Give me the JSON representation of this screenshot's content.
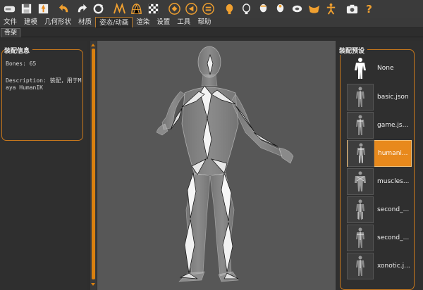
{
  "toolbar": {
    "icons": [
      "hard-drive-icon",
      "save-icon",
      "export-icon",
      "undo-icon",
      "redo-icon",
      "reset-icon",
      "wireframe-icon",
      "smooth-icon",
      "checker-icon",
      "front-view-icon",
      "back-view-icon",
      "side-view-icon",
      "head-front-icon",
      "head-side-icon",
      "head-back-icon",
      "head-top-icon",
      "face-icon",
      "arms-icon",
      "pose-icon",
      "camera-icon",
      "help-icon"
    ],
    "help_label": "?"
  },
  "menu": {
    "items": [
      "文件",
      "建模",
      "几何形状",
      "材质",
      "姿态/动画",
      "渲染",
      "设置",
      "工具",
      "帮助"
    ],
    "active_index": 4
  },
  "subtab": {
    "label": "骨架"
  },
  "info_panel": {
    "title": "装配信息",
    "bones_line": "Bones: 65",
    "description_line": "Description: 装配，用于Maya HumanIK"
  },
  "preset_panel": {
    "title": "装配预设",
    "items": [
      {
        "label": "None",
        "selected": false
      },
      {
        "label": "basic.json",
        "selected": false
      },
      {
        "label": "game.js...",
        "selected": false
      },
      {
        "label": "humani...",
        "selected": true
      },
      {
        "label": "muscles...",
        "selected": false
      },
      {
        "label": "second_...",
        "selected": false
      },
      {
        "label": "second_...",
        "selected": false
      },
      {
        "label": "xonotic.j...",
        "selected": false
      }
    ]
  },
  "colors": {
    "accent": "#d9800f",
    "panel_bg": "#2f2f2f",
    "viewport_bg": "#575757",
    "selected_bg": "#e8891c"
  }
}
